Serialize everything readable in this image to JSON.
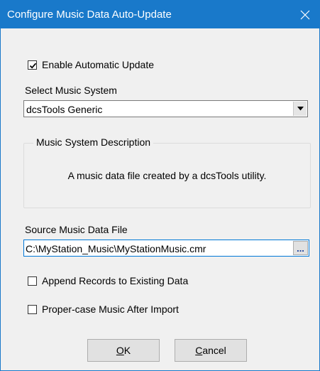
{
  "window": {
    "title": "Configure Music Data Auto-Update",
    "titlebar_color": "#1979ca"
  },
  "enable_update": {
    "label": "Enable Automatic Update",
    "checked": true
  },
  "music_system": {
    "label": "Select Music System",
    "selected": "dcsTools Generic"
  },
  "description_group": {
    "legend": "Music System Description",
    "text": "A music data file created by a dcsTools utility."
  },
  "source_file": {
    "label": "Source Music Data File",
    "value": "C:\\MyStation_Music\\MyStationMusic.cmr",
    "browse_label": "..."
  },
  "append_records": {
    "label": "Append Records to Existing Data",
    "checked": false
  },
  "proper_case": {
    "label": "Proper-case Music After Import",
    "checked": false
  },
  "buttons": {
    "ok_mnemonic": "O",
    "ok_rest": "K",
    "cancel_mnemonic": "C",
    "cancel_rest": "ancel"
  }
}
